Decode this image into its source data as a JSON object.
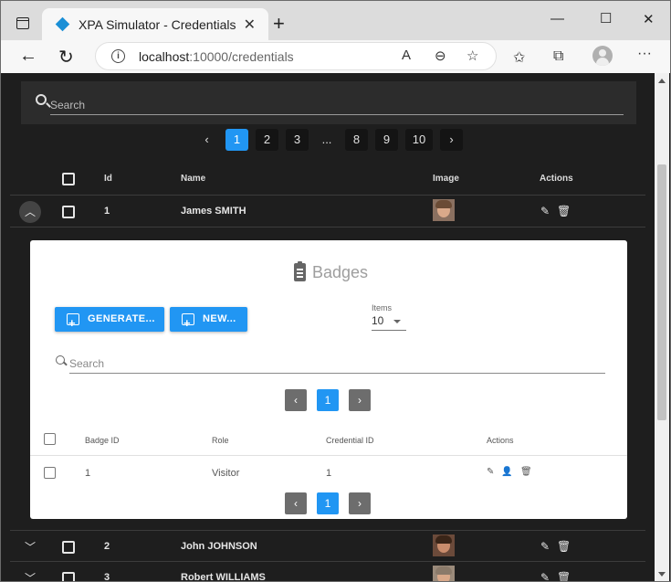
{
  "browser": {
    "tab_title": "XPA Simulator - Credentials",
    "url_host": "localhost",
    "url_rest": ":10000/credentials"
  },
  "search": {
    "placeholder": "Search"
  },
  "pager": {
    "pages": [
      "1",
      "2",
      "3",
      "...",
      "8",
      "9",
      "10"
    ],
    "active": "1"
  },
  "grid": {
    "headers": {
      "id": "Id",
      "name": "Name",
      "image": "Image",
      "actions": "Actions"
    },
    "rows": [
      {
        "id": "1",
        "name": "James SMITH"
      },
      {
        "id": "2",
        "name": "John JOHNSON"
      },
      {
        "id": "3",
        "name": "Robert WILLIAMS"
      }
    ]
  },
  "badges": {
    "title": "Badges",
    "generate_label": "GENERATE...",
    "new_label": "NEW...",
    "items_label": "Items",
    "items_value": "10",
    "search_placeholder": "Search",
    "pager_page": "1",
    "headers": {
      "badge_id": "Badge ID",
      "role": "Role",
      "credential_id": "Credential ID",
      "actions": "Actions"
    },
    "rows": [
      {
        "badge_id": "1",
        "role": "Visitor",
        "credential_id": "1"
      }
    ]
  },
  "colors": {
    "accent": "#2196f3",
    "page_bg": "#1e1e1e",
    "card_bg": "#ffffff"
  }
}
